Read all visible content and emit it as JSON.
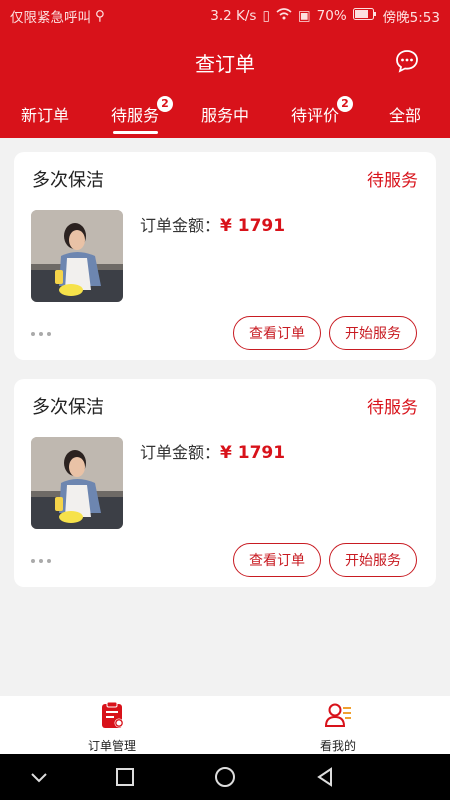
{
  "status_bar": {
    "carrier": "仅限紧急呼叫",
    "usb_icon": "usb-icon",
    "speed": "3.2 K/s",
    "battery": "70%",
    "time": "傍晚5:53"
  },
  "header": {
    "title": "查订单",
    "message_icon": "message-bubble-icon"
  },
  "tabs": [
    {
      "label": "新订单"
    },
    {
      "label": "待服务",
      "badge": "2",
      "active": true
    },
    {
      "label": "服务中"
    },
    {
      "label": "待评价",
      "badge": "2"
    },
    {
      "label": "全部"
    }
  ],
  "orders": [
    {
      "service": "多次保洁",
      "status": "待服务",
      "amount_label": "订单金额：",
      "amount": "¥ 1791",
      "view_btn": "查看订单",
      "start_btn": "开始服务"
    },
    {
      "service": "多次保洁",
      "status": "待服务",
      "amount_label": "订单金额：",
      "amount": "¥ 1791",
      "view_btn": "查看订单",
      "start_btn": "开始服务"
    }
  ],
  "bottom_nav": [
    {
      "label": "订单管理",
      "icon": "order-clipboard-icon",
      "active": true
    },
    {
      "label": "看我的",
      "icon": "user-profile-icon"
    }
  ],
  "colors": {
    "brand_red": "#d8121a",
    "background": "#f2f2f2"
  }
}
